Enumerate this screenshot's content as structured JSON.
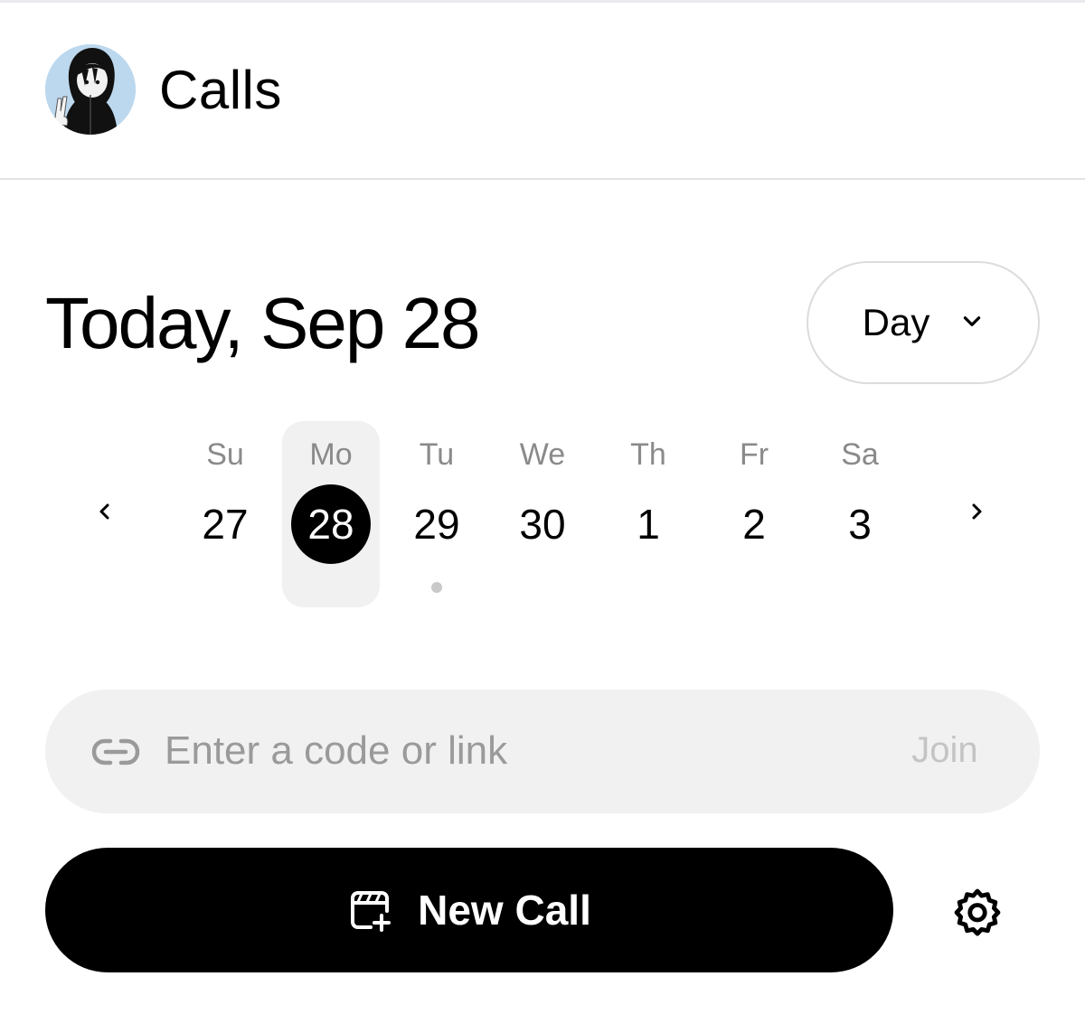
{
  "header": {
    "title": "Calls",
    "avatar": "user-avatar"
  },
  "date_heading": "Today, Sep 28",
  "view_selector": {
    "value": "Day",
    "icon": "chevron-down-icon"
  },
  "week": {
    "prev_icon": "chevron-left-icon",
    "next_icon": "chevron-right-icon",
    "days": [
      {
        "name": "Su",
        "date": "27",
        "selected": false,
        "has_event": false
      },
      {
        "name": "Mo",
        "date": "28",
        "selected": true,
        "has_event": false
      },
      {
        "name": "Tu",
        "date": "29",
        "selected": false,
        "has_event": true
      },
      {
        "name": "We",
        "date": "30",
        "selected": false,
        "has_event": false
      },
      {
        "name": "Th",
        "date": "1",
        "selected": false,
        "has_event": false
      },
      {
        "name": "Fr",
        "date": "2",
        "selected": false,
        "has_event": false
      },
      {
        "name": "Sa",
        "date": "3",
        "selected": false,
        "has_event": false
      }
    ]
  },
  "join": {
    "placeholder": "Enter a code or link",
    "value": "",
    "button_label": "Join",
    "icon": "link-icon"
  },
  "new_call": {
    "label": "New Call",
    "icon": "calendar-add-icon"
  },
  "settings_icon": "gear-icon"
}
